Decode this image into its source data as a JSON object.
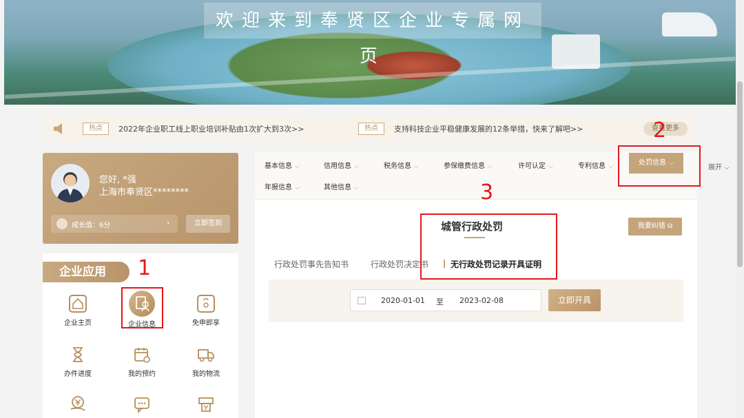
{
  "banner": {
    "title": "欢迎来到奉贤区企业专属网页"
  },
  "notice": {
    "items": [
      {
        "tag": "热点",
        "text": "2022年企业职工线上职业培训补贴由1次扩大到3次>>"
      },
      {
        "tag": "热点",
        "text": "支持科技企业平稳健康发展的12条举措，快来了解吧>>"
      }
    ],
    "more": "查看更多"
  },
  "user": {
    "greeting": "您好, *强",
    "region": "上海市奉贤区********",
    "growth": "成长值：6分",
    "signin": "立即签到"
  },
  "apps": {
    "title": "企业应用",
    "items": [
      {
        "label": "企业主页",
        "icon": "home-icon"
      },
      {
        "label": "企业信息",
        "icon": "company-info-icon"
      },
      {
        "label": "免申即享",
        "icon": "shopping-bag-icon"
      },
      {
        "label": "办件进度",
        "icon": "hourglass-icon"
      },
      {
        "label": "我的预约",
        "icon": "calendar-icon"
      },
      {
        "label": "我的物流",
        "icon": "truck-icon"
      },
      {
        "label": "",
        "icon": "yen-icon"
      },
      {
        "label": "",
        "icon": "chat-icon"
      },
      {
        "label": "",
        "icon": "printer-icon"
      }
    ]
  },
  "tabs": {
    "items": [
      "基本信息",
      "信用信息",
      "税务信息",
      "参保缴费信息",
      "许可认定",
      "专利信息",
      "处罚信息",
      "年报信息",
      "其他信息"
    ],
    "expand": "展开"
  },
  "section": {
    "title": "城管行政处罚",
    "report": "我要纠错",
    "subtabs": [
      "行政处罚事先告知书",
      "行政处罚决定书",
      "无行政处罚记录开具证明"
    ]
  },
  "query": {
    "start": "2020-01-01",
    "to": "至",
    "end": "2023-02-08",
    "button": "立即开具"
  },
  "annotations": [
    "1",
    "2",
    "3"
  ],
  "colors": {
    "accent": "#c4a47a",
    "annotation": "#e0181b"
  }
}
